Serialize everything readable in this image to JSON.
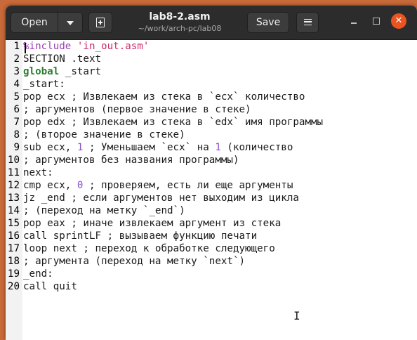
{
  "window": {
    "title": "lab8-2.asm",
    "path": "~/work/arch-pc/lab08"
  },
  "toolbar": {
    "open_label": "Open",
    "save_label": "Save"
  },
  "colors": {
    "close_button": "#e95420",
    "headerbar": "#2c2c2c"
  },
  "editor": {
    "lines": [
      {
        "n": "1",
        "segs": [
          {
            "t": "%include ",
            "c": "pp"
          },
          {
            "t": "'in_out.asm'",
            "c": "str"
          }
        ]
      },
      {
        "n": "2",
        "segs": [
          {
            "t": "SECTION .text",
            "c": "txt"
          }
        ]
      },
      {
        "n": "3",
        "segs": [
          {
            "t": "global",
            "c": "kw"
          },
          {
            "t": " _start",
            "c": "txt"
          }
        ]
      },
      {
        "n": "4",
        "segs": [
          {
            "t": "_start:",
            "c": "txt"
          }
        ]
      },
      {
        "n": "5",
        "segs": [
          {
            "t": "pop ecx ; Извлекаем из стека в `ecx` количество",
            "c": "txt"
          }
        ]
      },
      {
        "n": "6",
        "segs": [
          {
            "t": "; аргументов (первое значение в стеке)",
            "c": "txt"
          }
        ]
      },
      {
        "n": "7",
        "segs": [
          {
            "t": "pop edx ; Извлекаем из стека в `edx` имя программы",
            "c": "txt"
          }
        ]
      },
      {
        "n": "8",
        "segs": [
          {
            "t": "; (второе значение в стеке)",
            "c": "txt"
          }
        ]
      },
      {
        "n": "9",
        "segs": [
          {
            "t": "sub ecx, ",
            "c": "txt"
          },
          {
            "t": "1",
            "c": "num"
          },
          {
            "t": " ; Уменьшаем `ecx` на ",
            "c": "txt"
          },
          {
            "t": "1",
            "c": "num"
          },
          {
            "t": " (количество",
            "c": "txt"
          }
        ]
      },
      {
        "n": "10",
        "segs": [
          {
            "t": "; аргументов без названия программы)",
            "c": "txt"
          }
        ]
      },
      {
        "n": "11",
        "segs": [
          {
            "t": "next:",
            "c": "txt"
          }
        ]
      },
      {
        "n": "12",
        "segs": [
          {
            "t": "cmp ecx, ",
            "c": "txt"
          },
          {
            "t": "0",
            "c": "num"
          },
          {
            "t": " ; проверяем, есть ли еще аргументы",
            "c": "txt"
          }
        ]
      },
      {
        "n": "13",
        "segs": [
          {
            "t": "jz _end ; если аргументов нет выходим из цикла",
            "c": "txt"
          }
        ]
      },
      {
        "n": "14",
        "segs": [
          {
            "t": "; (переход на метку `_end`)",
            "c": "txt"
          }
        ]
      },
      {
        "n": "15",
        "segs": [
          {
            "t": "pop eax ; иначе извлекаем аргумент из стека",
            "c": "txt"
          }
        ]
      },
      {
        "n": "16",
        "segs": [
          {
            "t": "call sprintLF ; вызываем функцию печати",
            "c": "txt"
          }
        ]
      },
      {
        "n": "17",
        "segs": [
          {
            "t": "loop next ; переход к обработке следующего",
            "c": "txt"
          }
        ]
      },
      {
        "n": "18",
        "segs": [
          {
            "t": "; аргумента (переход на метку `next`)",
            "c": "txt"
          }
        ]
      },
      {
        "n": "19",
        "segs": [
          {
            "t": "_end:",
            "c": "txt"
          }
        ]
      },
      {
        "n": "20",
        "segs": [
          {
            "t": "call quit",
            "c": "txt"
          }
        ]
      }
    ]
  },
  "icons": {
    "open_menu": "chevron-down-icon",
    "new_document": "new-document-icon",
    "main_menu": "hamburger-menu-icon",
    "minimize": "minimize-icon",
    "maximize": "maximize-icon",
    "close": "close-icon",
    "mouse_cursor": "text-cursor-icon"
  }
}
